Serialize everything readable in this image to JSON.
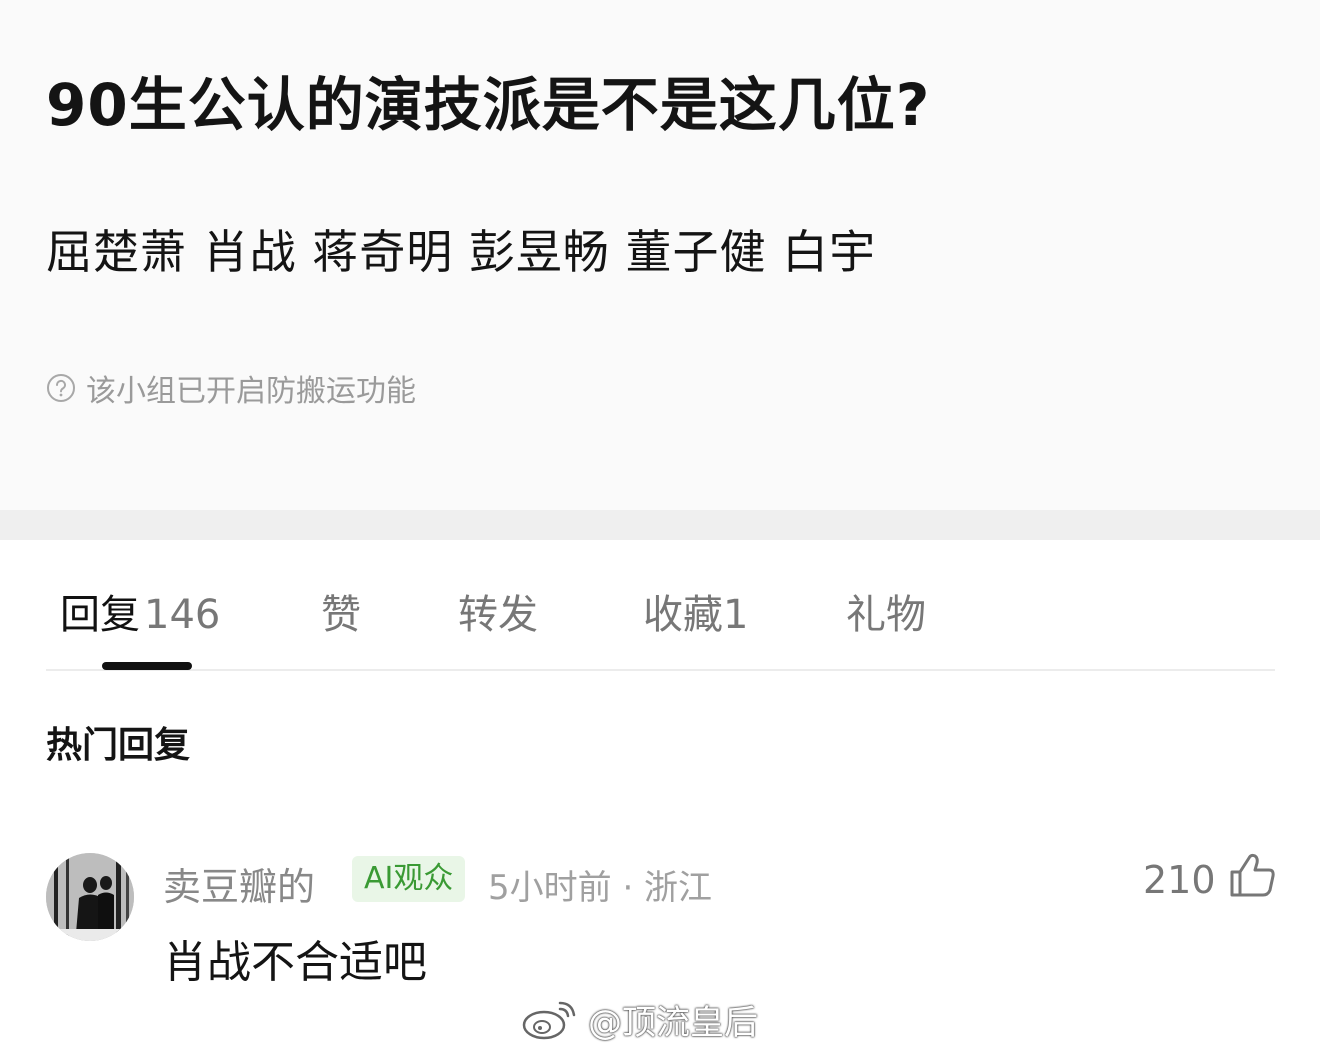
{
  "post": {
    "title": "90生公认的演技派是不是这几位?",
    "body": "屈楚萧 肖战 蒋奇明 彭昱畅 董子健 白宇",
    "notice": "该小组已开启防搬运功能",
    "notice_icon": "question-circle-icon"
  },
  "tabs": [
    {
      "label": "回复",
      "count": "146",
      "active": true
    },
    {
      "label": "赞",
      "count": ""
    },
    {
      "label": "转发",
      "count": ""
    },
    {
      "label": "收藏",
      "count": "1"
    },
    {
      "label": "礼物",
      "count": ""
    }
  ],
  "section": {
    "title": "热门回复"
  },
  "comment": {
    "username": "卖豆瓣的",
    "badge": "AI观众",
    "meta": "5小时前 · 浙江",
    "likes": "210",
    "like_icon": "thumbs-up-icon",
    "text": "肖战不合适吧"
  },
  "watermark": {
    "text": "@顶流皇后",
    "icon": "weibo-logo-icon"
  },
  "colors": {
    "badge_bg": "#e9f6e7",
    "badge_text": "#3a9a34",
    "muted": "#9a9a9a"
  }
}
